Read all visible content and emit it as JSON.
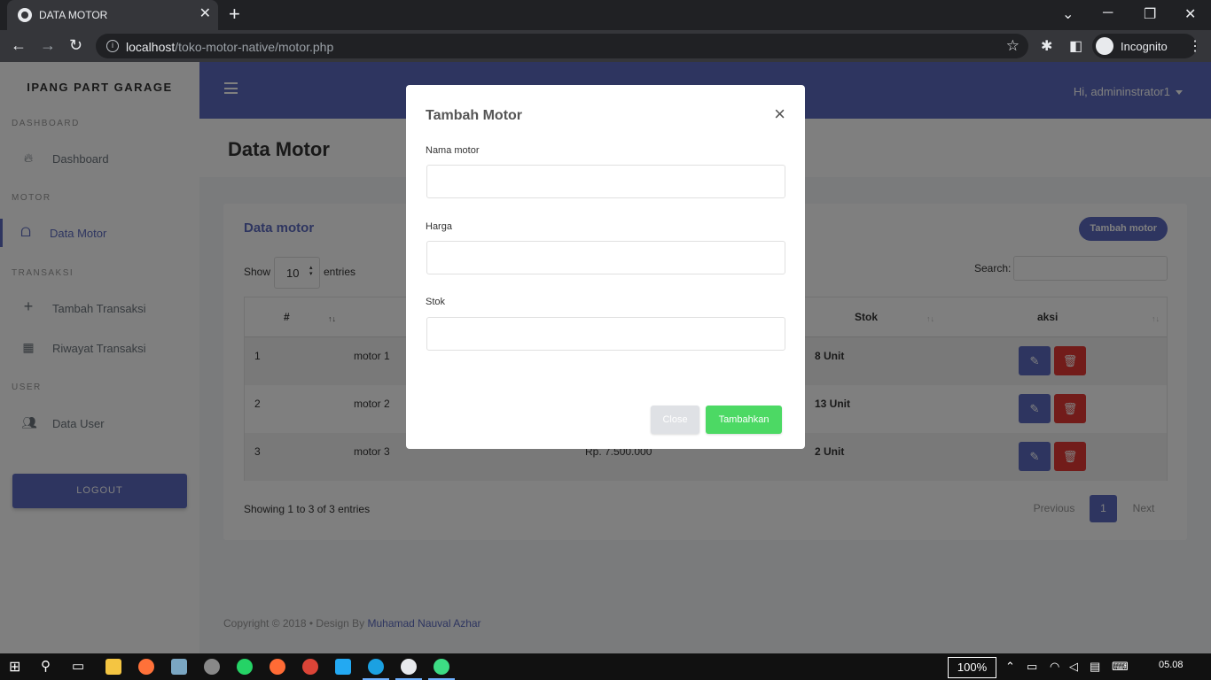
{
  "browser": {
    "tab_title": "DATA MOTOR",
    "tab_close": "✕",
    "new_tab": "+",
    "url_host": "localhost",
    "url_path": "/toko-motor-native/motor.php",
    "incognito_label": "Incognito"
  },
  "sidebar": {
    "brand": "IPANG PART GARAGE",
    "sections": [
      {
        "title": "DASHBOARD",
        "items": [
          {
            "label": "Dashboard",
            "icon": "fire-icon"
          }
        ]
      },
      {
        "title": "MOTOR",
        "items": [
          {
            "label": "Data Motor",
            "icon": "motorcycle-icon",
            "active": true
          }
        ]
      },
      {
        "title": "TRANSAKSI",
        "items": [
          {
            "label": "Tambah Transaksi",
            "icon": "plus-icon"
          },
          {
            "label": "Riwayat Transaksi",
            "icon": "grid-icon"
          }
        ]
      },
      {
        "title": "USER",
        "items": [
          {
            "label": "Data User",
            "icon": "users-icon"
          }
        ]
      }
    ],
    "logout_label": "LOGOUT"
  },
  "topbar": {
    "user_greeting": "Hi, admininstrator1"
  },
  "page": {
    "title": "Data Motor"
  },
  "card": {
    "title": "Data motor",
    "add_button": "Tambah motor",
    "show_label": "Show",
    "page_length": "10",
    "entries_label": "entries",
    "search_label": "Search:",
    "columns": [
      "#",
      "Stok",
      "aksi"
    ],
    "rows": [
      {
        "no": "1",
        "nama": "motor 1",
        "harga": "",
        "stok": "8 Unit"
      },
      {
        "no": "2",
        "nama": "motor 2",
        "harga": "",
        "stok": "13 Unit"
      },
      {
        "no": "3",
        "nama": "motor 3",
        "harga": "Rp. 7.500.000",
        "stok": "2 Unit"
      }
    ],
    "showing_text": "Showing 1 to 3 of 3 entries",
    "pagination": {
      "previous": "Previous",
      "current": "1",
      "next": "Next"
    }
  },
  "footer": {
    "text": "Copyright © 2018  •  Design By ",
    "author": "Muhamad Nauval Azhar"
  },
  "modal": {
    "title": "Tambah Motor",
    "close_icon": "×",
    "fields": [
      {
        "label": "Nama motor",
        "value": ""
      },
      {
        "label": "Harga",
        "value": ""
      },
      {
        "label": "Stok",
        "value": ""
      }
    ],
    "close_button": "Close",
    "submit_button": "Tambahkan"
  },
  "taskbar": {
    "zoom": "100%",
    "clock": "05.08"
  },
  "colors": {
    "primary": "#5c6bc0",
    "danger": "#e53935",
    "success": "#4cd964"
  }
}
